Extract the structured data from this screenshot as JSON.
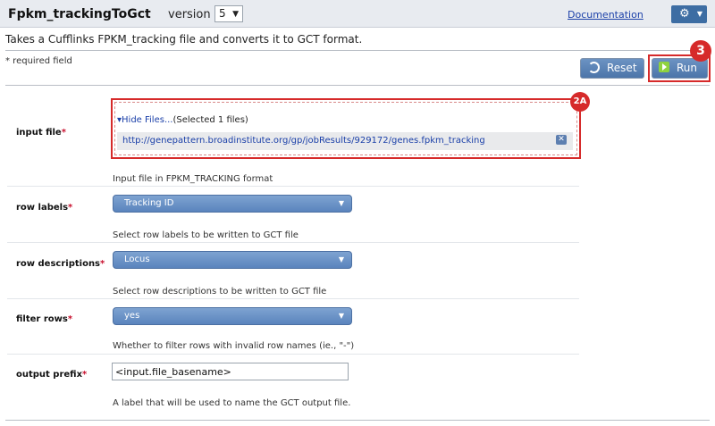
{
  "header": {
    "module_name": "Fpkm_trackingToGct",
    "version_label": "version",
    "version_value": "5",
    "documentation_link": "Documentation",
    "accent_color": "#3d6da3"
  },
  "description": "Takes a Cufflinks FPKM_tracking file and converts it to GCT format.",
  "required_note": "* required field",
  "actions": {
    "reset_label": "Reset",
    "run_label": "Run",
    "run_callout": "3"
  },
  "form": {
    "input_file": {
      "label": "input file",
      "required_mark": "*",
      "callout": "2A",
      "toggle_label": "Hide Files...",
      "selected_count": "(Selected 1 files)",
      "file_url": "http://genepattern.broadinstitute.org/gp/jobResults/929172/genes.fpkm_tracking",
      "help": "Input file in FPKM_TRACKING format"
    },
    "row_labels": {
      "label": "row labels",
      "required_mark": "*",
      "value": "Tracking ID",
      "help": "Select row labels to be written to GCT file"
    },
    "row_descriptions": {
      "label": "row descriptions",
      "required_mark": "*",
      "value": "Locus",
      "help": "Select row descriptions to be written to GCT file"
    },
    "filter_rows": {
      "label": "filter rows",
      "required_mark": "*",
      "value": "yes",
      "help": "Whether to filter rows with invalid row names (ie., \"-\")"
    },
    "output_prefix": {
      "label": "output prefix",
      "required_mark": "*",
      "value": "<input.file_basename>",
      "help": "A label that will be used to name the GCT output file."
    }
  },
  "icons": [
    "gear-icon",
    "chevron-down-icon",
    "refresh-icon",
    "play-icon",
    "remove-icon",
    "triangle-down-icon"
  ],
  "highlight_color": "#d62a2a"
}
